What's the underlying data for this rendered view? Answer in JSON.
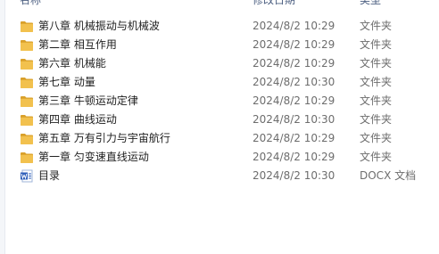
{
  "columns": {
    "name": "名称",
    "modified": "修改日期",
    "type": "类型"
  },
  "files": [
    {
      "name": "第八章 机械振动与机械波",
      "modified": "2024/8/2 10:29",
      "type": "文件夹",
      "icon": "folder-icon"
    },
    {
      "name": "第二章 相互作用",
      "modified": "2024/8/2 10:29",
      "type": "文件夹",
      "icon": "folder-icon"
    },
    {
      "name": "第六章 机械能",
      "modified": "2024/8/2 10:29",
      "type": "文件夹",
      "icon": "folder-icon"
    },
    {
      "name": "第七章 动量",
      "modified": "2024/8/2 10:30",
      "type": "文件夹",
      "icon": "folder-icon"
    },
    {
      "name": "第三章 牛顿运动定律",
      "modified": "2024/8/2 10:29",
      "type": "文件夹",
      "icon": "folder-icon"
    },
    {
      "name": "第四章 曲线运动",
      "modified": "2024/8/2 10:30",
      "type": "文件夹",
      "icon": "folder-icon"
    },
    {
      "name": "第五章 万有引力与宇宙航行",
      "modified": "2024/8/2 10:29",
      "type": "文件夹",
      "icon": "folder-icon"
    },
    {
      "name": "第一章 匀变速直线运动",
      "modified": "2024/8/2 10:29",
      "type": "文件夹",
      "icon": "folder-icon"
    },
    {
      "name": "目录",
      "modified": "2024/8/2 10:30",
      "type": "DOCX 文档",
      "icon": "word-document-icon"
    }
  ],
  "colors": {
    "folder": "#f2c14e",
    "folder_dark": "#d9a02a",
    "word": "#2b5cb8"
  }
}
